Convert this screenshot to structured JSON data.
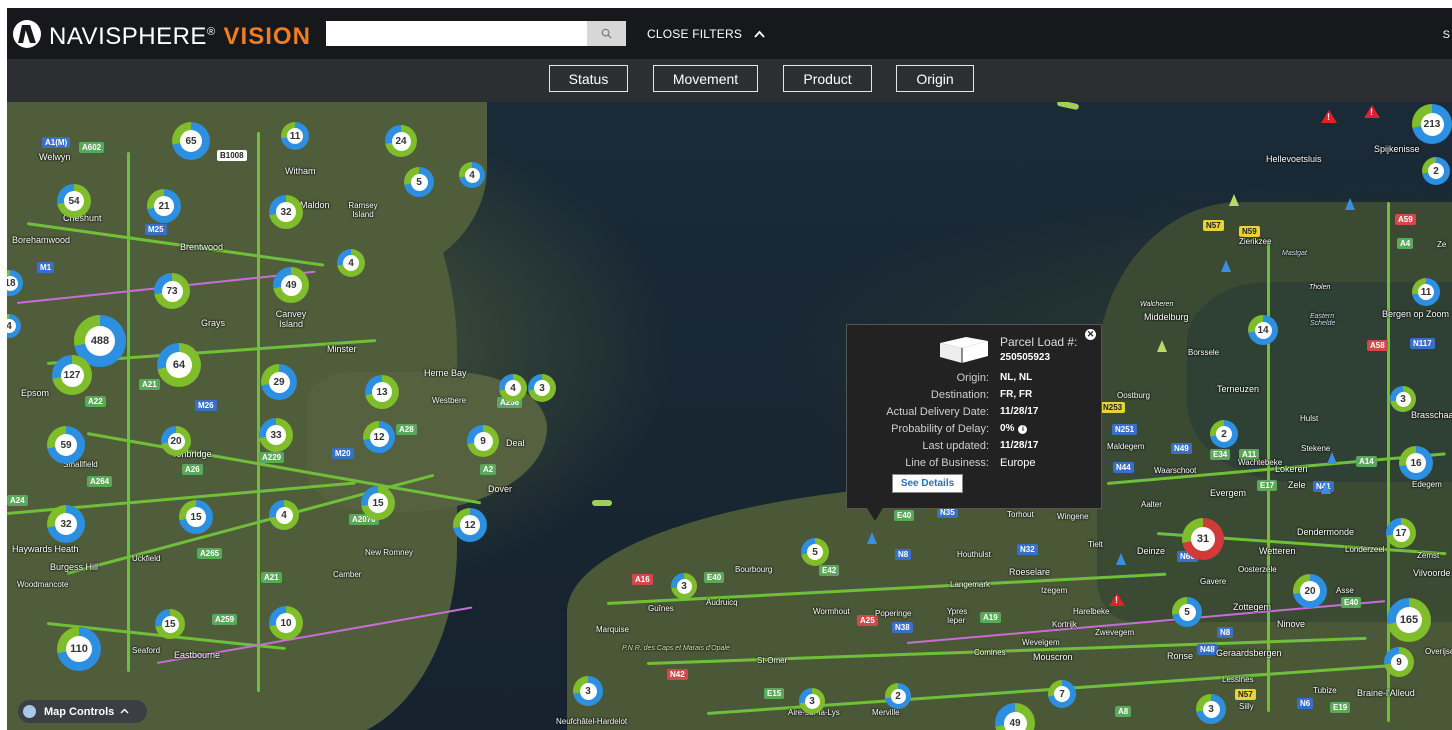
{
  "header": {
    "brand_main": "NAVISPHERE",
    "brand_reg": "®",
    "brand_accent": "VISION",
    "search_placeholder": "",
    "search_icon": "search-icon",
    "filters_toggle_label": "CLOSE FILTERS",
    "user_initial": "S"
  },
  "filters": {
    "buttons": [
      "Status",
      "Movement",
      "Product",
      "Origin"
    ]
  },
  "popup": {
    "title_label": "Parcel Load #:",
    "load_number": "250505923",
    "rows": [
      {
        "label": "Origin:",
        "value": "NL, NL"
      },
      {
        "label": "Destination:",
        "value": "FR, FR"
      },
      {
        "label": "Actual Delivery Date:",
        "value": "11/28/17"
      },
      {
        "label": "Probability of Delay:",
        "value": "0%"
      },
      {
        "label": "Last updated:",
        "value": "11/28/17"
      },
      {
        "label": "Line of Business:",
        "value": "Europe"
      }
    ],
    "see_details_label": "See Details",
    "close_icon": "close-icon",
    "info_icon": "info-icon"
  },
  "map_controls_label": "Map Controls",
  "towns": [
    "Welwyn",
    "Witham",
    "Maldon",
    "Ramsey Island",
    "Cheshunt",
    "Borehamwood",
    "Brentwood",
    "Canvey Island",
    "Grays",
    "Minster",
    "Herne Bay",
    "Westbere",
    "Deal",
    "Dover",
    "Epsom",
    "Smallfield",
    "Tonbridge",
    "Haywards Heath",
    "Burgess Hill",
    "Woodmancote",
    "Uckfield",
    "New Romney",
    "Camber",
    "Seaford",
    "Eastbourne",
    "Bourbourg",
    "Audruicq",
    "Guînes",
    "Marquise",
    "Wormhout",
    "Poperinge",
    "Ypres Ieper",
    "Houthulst",
    "Langemark",
    "Roeselare",
    "Izegem",
    "Harelbeke",
    "Kortrijk",
    "Zwevegem",
    "Wevelgem",
    "Mouscron",
    "Comines",
    "St-Omer",
    "Aire-sur-la-Lys",
    "Merville",
    "Neufchâtel-Hardelot",
    "Torhout",
    "Wingene",
    "Tielt",
    "Deinze",
    "Aalter",
    "Maldegem",
    "Waarschoot",
    "Evergem",
    "Lokeren",
    "Zele",
    "Dendermonde",
    "Wetteren",
    "Oosterzele",
    "Gavere",
    "Zottegem",
    "Ninove",
    "Geraardsbergen",
    "Ronse",
    "Lessines",
    "Silly",
    "Tubize",
    "Braine-l'Alleud",
    "Asse",
    "Londerzeel",
    "Zemst",
    "Vilvoorde",
    "Edegem",
    "Brasschaat",
    "Hulst",
    "Stekene",
    "Wachtebeke",
    "Terneuzen",
    "Oostburg",
    "Borssele",
    "Middelburg",
    "Walcheren",
    "Eastern Schelde",
    "Tholen",
    "Bergen op Zoom",
    "Zierikzee",
    "Hellevoetsluis",
    "Spijkenisse",
    "Mastgat",
    "P.N.R. des Caps et Marais d'Opale",
    "Overijse",
    "Ze"
  ],
  "clusters": [
    "65",
    "11",
    "24",
    "5",
    "4",
    "54",
    "21",
    "32",
    "4",
    "73",
    "49",
    "488",
    "64",
    "127",
    "29",
    "13",
    "4",
    "3",
    "59",
    "20",
    "33",
    "12",
    "9",
    "32",
    "15",
    "4",
    "15",
    "12",
    "15",
    "10",
    "110",
    "3",
    "5",
    "3",
    "3",
    "2",
    "7",
    "49",
    "14",
    "2",
    "3",
    "31",
    "20",
    "16",
    "17",
    "11",
    "2",
    "213",
    "5",
    "165",
    "9",
    "18",
    "4",
    "3"
  ]
}
